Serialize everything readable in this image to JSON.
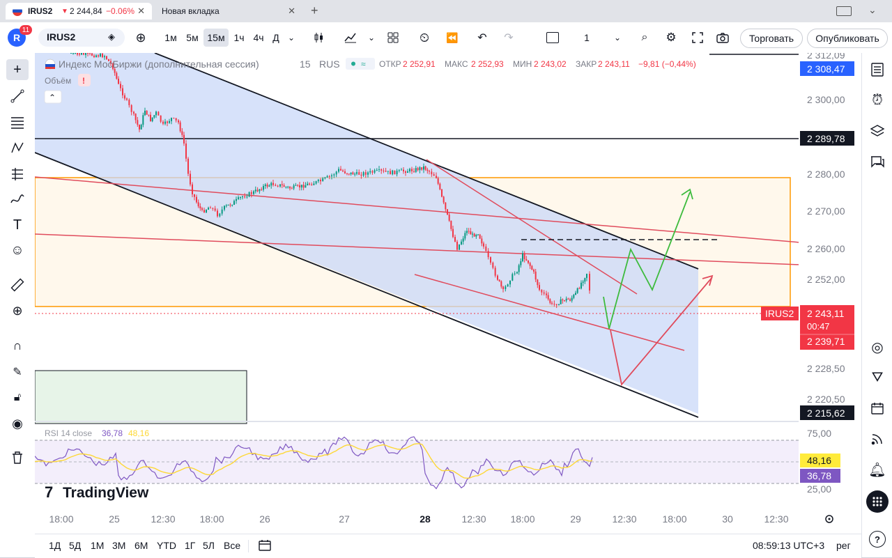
{
  "browser": {
    "active_tab": {
      "title": "IRUS2",
      "arrow": "▼",
      "price": "2 244,84",
      "change": "−0.06%"
    },
    "new_tab": {
      "title": "Новая вкладка"
    },
    "plus": "+"
  },
  "toolbar": {
    "avatar_letter": "R",
    "notifications": "11",
    "symbol": "IRUS2",
    "intervals": [
      "1м",
      "5м",
      "15м",
      "1ч",
      "4ч",
      "Д"
    ],
    "active_interval": "15м",
    "layout_count": "1",
    "trade_label": "Торговать",
    "publish_label": "Опубликовать"
  },
  "legend": {
    "name": "Индекс МосБиржи (дополнительная сессия)",
    "interval": "15",
    "exchange": "RUS",
    "open_label": "ОТКР",
    "open": "2 252,91",
    "high_label": "МАКС",
    "high": "2 252,93",
    "low_label": "МИН",
    "low": "2 243,02",
    "close_label": "ЗАКР",
    "close": "2 243,11",
    "change": "−9,81 (−0,44%)",
    "volume_label": "Объём",
    "volume_warning": "!"
  },
  "price_axis": {
    "ticks": [
      "2 312,09",
      "2 300,00",
      "2 280,00",
      "2 270,00",
      "2 260,00",
      "2 252,00",
      "2 228,50",
      "2 220,50"
    ],
    "top_box": "2 308,47",
    "line_label": "2 289,78",
    "symbol_tag": "IRUS2",
    "last_price": "2 243,11",
    "countdown": "00:47",
    "red_box": "2 239,71",
    "bottom_box": "2 215,62"
  },
  "rsi": {
    "title": "RSI 14 close",
    "value1": "36,78",
    "value2": "48,16",
    "ticks": [
      "75,00",
      "25,00"
    ],
    "box1": "48,16",
    "box2": "36,78"
  },
  "watermark": "TradingView",
  "time_axis": [
    "18:00",
    "25",
    "12:30",
    "18:00",
    "26",
    "27",
    "28",
    "12:30",
    "18:00",
    "29",
    "12:30",
    "18:00",
    "30",
    "12:30"
  ],
  "bottom": {
    "ranges": [
      "1Д",
      "5Д",
      "1М",
      "3М",
      "6М",
      "YTD",
      "1Г",
      "5Л",
      "Все"
    ],
    "clock": "08:59:13 UTC+3",
    "mode": "рег"
  },
  "colors": {
    "down": "#f23645",
    "up": "#089981",
    "channel_fill": "#d6e2fb",
    "zone_fill": "#fff8ec",
    "zone_border": "#ff9800",
    "rsi_line": "#7e57c2",
    "rsi_ma": "#fdd835"
  }
}
